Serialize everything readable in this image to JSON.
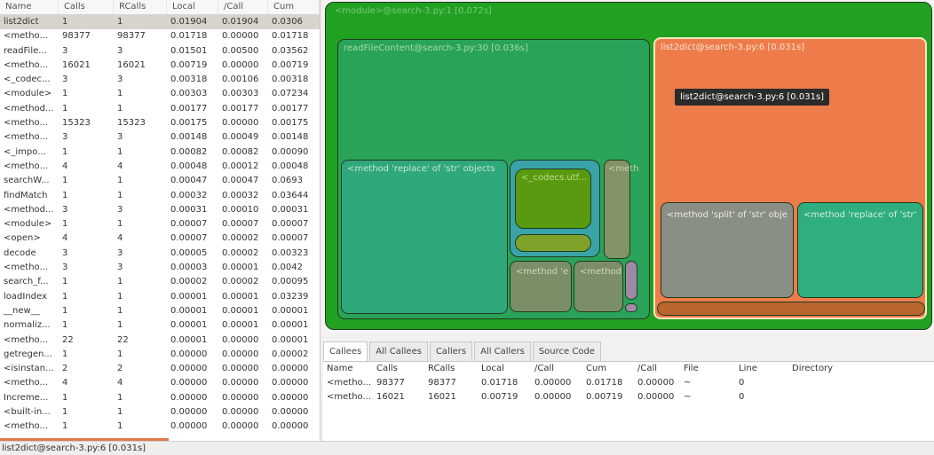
{
  "left_table": {
    "headers": [
      "Name",
      "Calls",
      "RCalls",
      "Local",
      "/Call",
      "Cum"
    ],
    "rows": [
      [
        "list2dict",
        "1",
        "1",
        "0.01904",
        "0.01904",
        "0.0306"
      ],
      [
        "<metho...",
        "98377",
        "98377",
        "0.01718",
        "0.00000",
        "0.01718"
      ],
      [
        "readFile...",
        "3",
        "3",
        "0.01501",
        "0.00500",
        "0.03562"
      ],
      [
        "<metho...",
        "16021",
        "16021",
        "0.00719",
        "0.00000",
        "0.00719"
      ],
      [
        "<_codec...",
        "3",
        "3",
        "0.00318",
        "0.00106",
        "0.00318"
      ],
      [
        "<module>",
        "1",
        "1",
        "0.00303",
        "0.00303",
        "0.07234"
      ],
      [
        "<method...",
        "1",
        "1",
        "0.00177",
        "0.00177",
        "0.00177"
      ],
      [
        "<metho...",
        "15323",
        "15323",
        "0.00175",
        "0.00000",
        "0.00175"
      ],
      [
        "<metho...",
        "3",
        "3",
        "0.00148",
        "0.00049",
        "0.00148"
      ],
      [
        "<_impo...",
        "1",
        "1",
        "0.00082",
        "0.00082",
        "0.00090"
      ],
      [
        "<metho...",
        "4",
        "4",
        "0.00048",
        "0.00012",
        "0.00048"
      ],
      [
        "searchW...",
        "1",
        "1",
        "0.00047",
        "0.00047",
        "0.0693"
      ],
      [
        "findMatch",
        "1",
        "1",
        "0.00032",
        "0.00032",
        "0.03644"
      ],
      [
        "<method...",
        "3",
        "3",
        "0.00031",
        "0.00010",
        "0.00031"
      ],
      [
        "<module>",
        "1",
        "1",
        "0.00007",
        "0.00007",
        "0.00007"
      ],
      [
        "<open>",
        "4",
        "4",
        "0.00007",
        "0.00002",
        "0.00007"
      ],
      [
        "decode",
        "3",
        "3",
        "0.00005",
        "0.00002",
        "0.00323"
      ],
      [
        "<metho...",
        "3",
        "3",
        "0.00003",
        "0.00001",
        "0.0042"
      ],
      [
        "search_f...",
        "1",
        "1",
        "0.00002",
        "0.00002",
        "0.00095"
      ],
      [
        "loadIndex",
        "1",
        "1",
        "0.00001",
        "0.00001",
        "0.03239"
      ],
      [
        "__new__",
        "1",
        "1",
        "0.00001",
        "0.00001",
        "0.00001"
      ],
      [
        "normaliz...",
        "1",
        "1",
        "0.00001",
        "0.00001",
        "0.00001"
      ],
      [
        "<metho...",
        "22",
        "22",
        "0.00001",
        "0.00000",
        "0.00001"
      ],
      [
        "getregen...",
        "1",
        "1",
        "0.00000",
        "0.00000",
        "0.00002"
      ],
      [
        "<isinstan...",
        "2",
        "2",
        "0.00000",
        "0.00000",
        "0.00000"
      ],
      [
        "<metho...",
        "4",
        "4",
        "0.00000",
        "0.00000",
        "0.00000"
      ],
      [
        "Increme...",
        "1",
        "1",
        "0.00000",
        "0.00000",
        "0.00000"
      ],
      [
        "<built-in...",
        "1",
        "1",
        "0.00000",
        "0.00000",
        "0.00000"
      ],
      [
        "<metho...",
        "1",
        "1",
        "0.00000",
        "0.00000",
        "0.00000"
      ]
    ]
  },
  "map": {
    "root_label": "<module>@search-3.py:1 [0.072s]",
    "read_label": "readFileContent@search-3.py:30 [0.036s]",
    "read_replace_label": "<method 'replace' of 'str' objects",
    "codecs_label": "<_codecs.utf...",
    "meth_label": "<meth",
    "method_e_label": "<method 'e",
    "method_label": "<method",
    "list2dict_label": "list2dict@search-3.py:6 [0.031s]",
    "split_label": "<method 'split' of 'str' obje",
    "replace2_label": "<method 'replace' of 'str'",
    "tooltip": "list2dict@search-3.py:6 [0.031s]",
    "colors": {
      "green": "#22a022",
      "teal": "#2fae7e",
      "orange": "#ee7c4a",
      "olive": "#6e9a24",
      "grey": "#8a8a6a",
      "violet": "#9f8aa5"
    }
  },
  "tabs": [
    "Callees",
    "All Callees",
    "Callers",
    "All Callers",
    "Source Code"
  ],
  "bottom_table": {
    "headers": [
      "Name",
      "Calls",
      "RCalls",
      "Local",
      "/Call",
      "Cum",
      "/Call",
      "File",
      "Line",
      "Directory"
    ],
    "rows": [
      [
        "<metho...",
        "98377",
        "98377",
        "0.01718",
        "0.00000",
        "0.01718",
        "0.00000",
        "~",
        "0",
        ""
      ],
      [
        "<metho...",
        "16021",
        "16021",
        "0.00719",
        "0.00000",
        "0.00719",
        "0.00000",
        "~",
        "0",
        ""
      ]
    ]
  },
  "status": "list2dict@search-3.py:6 [0.031s]"
}
